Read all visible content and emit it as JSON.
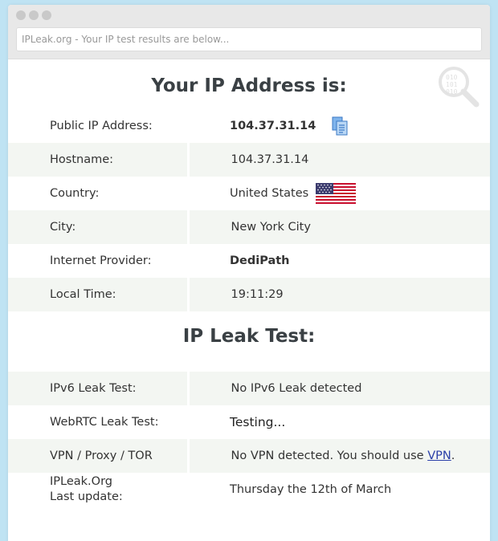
{
  "browser": {
    "address_text": "IPLeak.org - Your IP test results are below..."
  },
  "ip_section": {
    "title": "Your IP Address is:",
    "rows": [
      {
        "label": "Public IP Address:",
        "value": "104.37.31.14"
      },
      {
        "label": "Hostname:",
        "value": "104.37.31.14"
      },
      {
        "label": "Country:",
        "value": "United States"
      },
      {
        "label": "City:",
        "value": "New York City"
      },
      {
        "label": "Internet Provider:",
        "value": "DediPath"
      },
      {
        "label": "Local Time:",
        "value": "19:11:29"
      }
    ]
  },
  "leak_section": {
    "title": "IP Leak Test:",
    "rows": [
      {
        "label": "IPv6 Leak Test:",
        "value": "No IPv6 Leak detected"
      },
      {
        "label": "WebRTC Leak Test:",
        "value": "Testing..."
      },
      {
        "label": "VPN / Proxy / TOR",
        "value": "No VPN detected. You should use ",
        "link": "VPN",
        "suffix": "."
      },
      {
        "label_line1": "IPLeak.Org",
        "label_line2": "Last update:",
        "value": "Thursday the 12th of March"
      }
    ]
  },
  "icons": {
    "copy": "copy-icon",
    "flag": "us-flag-icon",
    "magnifier": "magnifier-binary-icon"
  },
  "colors": {
    "background": "#bfe3f3",
    "row_alt": "#f3f6f2",
    "heading": "#3a4044",
    "link": "#2a3fa8"
  }
}
